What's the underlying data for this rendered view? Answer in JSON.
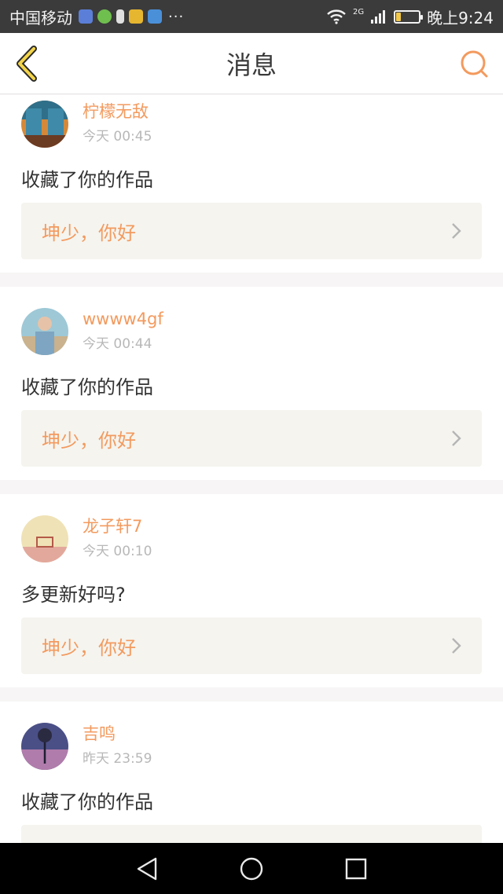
{
  "status_bar": {
    "carrier": "中国移动",
    "network": "2G",
    "time": "晚上9:24",
    "battery_level": 0.2,
    "more": "···"
  },
  "header": {
    "title": "消息",
    "back_icon": "chevron-left-icon",
    "search_icon": "search-icon"
  },
  "messages": [
    {
      "username": "柠檬无敌",
      "time": "今天 00:45",
      "text": "收藏了你的作品",
      "reply": "坤少，你好"
    },
    {
      "username": "wwww4gf",
      "time": "今天 00:44",
      "text": "收藏了你的作品",
      "reply": "坤少，你好"
    },
    {
      "username": "龙子轩7",
      "time": "今天 00:10",
      "text": "多更新好吗?",
      "reply": "坤少，你好"
    },
    {
      "username": "吉鸣",
      "time": "昨天 23:59",
      "text": "收藏了你的作品",
      "reply": ""
    }
  ],
  "nav": {
    "back": "back-triangle-icon",
    "home": "home-circle-icon",
    "recent": "recent-square-icon"
  },
  "colors": {
    "accent": "#f39a5e",
    "header_bg": "#ffffff",
    "status_bg": "#3b3b3b",
    "reply_bg": "#f5f4ef"
  }
}
